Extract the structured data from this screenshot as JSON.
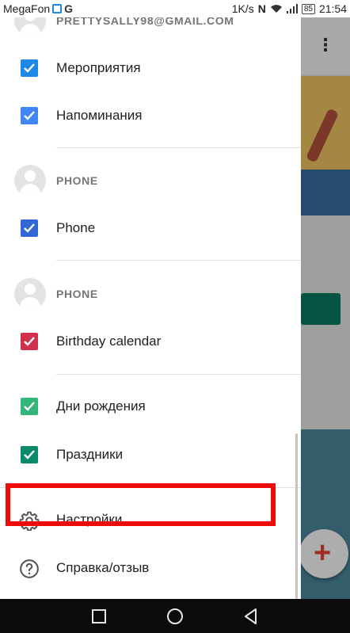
{
  "status_bar": {
    "carrier": "MegaFon",
    "g_label": "G",
    "speed": "1K/s",
    "nfc": "N",
    "battery": "85",
    "time": "21:54"
  },
  "drawer": {
    "accounts": [
      {
        "name": "PRETTYSALLY98@GMAIL.COM",
        "calendars": [
          {
            "label": "Мероприятия",
            "color": "#1e88e5",
            "checked": true
          },
          {
            "label": "Напоминания",
            "color": "#4285f4",
            "checked": true
          }
        ]
      },
      {
        "name": "PHONE",
        "calendars": [
          {
            "label": "Phone",
            "color": "#3367d6",
            "checked": true
          }
        ]
      },
      {
        "name": "PHONE",
        "calendars": [
          {
            "label": "Birthday calendar",
            "color": "#d0304b",
            "checked": true
          }
        ]
      },
      {
        "name": "",
        "calendars": [
          {
            "label": "Дни рождения",
            "color": "#33b679",
            "checked": true
          },
          {
            "label": "Праздники",
            "color": "#0b8a6b",
            "checked": true
          }
        ]
      }
    ],
    "menu": [
      {
        "label": "Настройки",
        "icon": "gear-icon"
      },
      {
        "label": "Справка/отзыв",
        "icon": "help-icon"
      }
    ]
  },
  "colors": {
    "highlight": "#f00a0a",
    "text_primary": "#212121",
    "text_secondary": "#757575"
  }
}
